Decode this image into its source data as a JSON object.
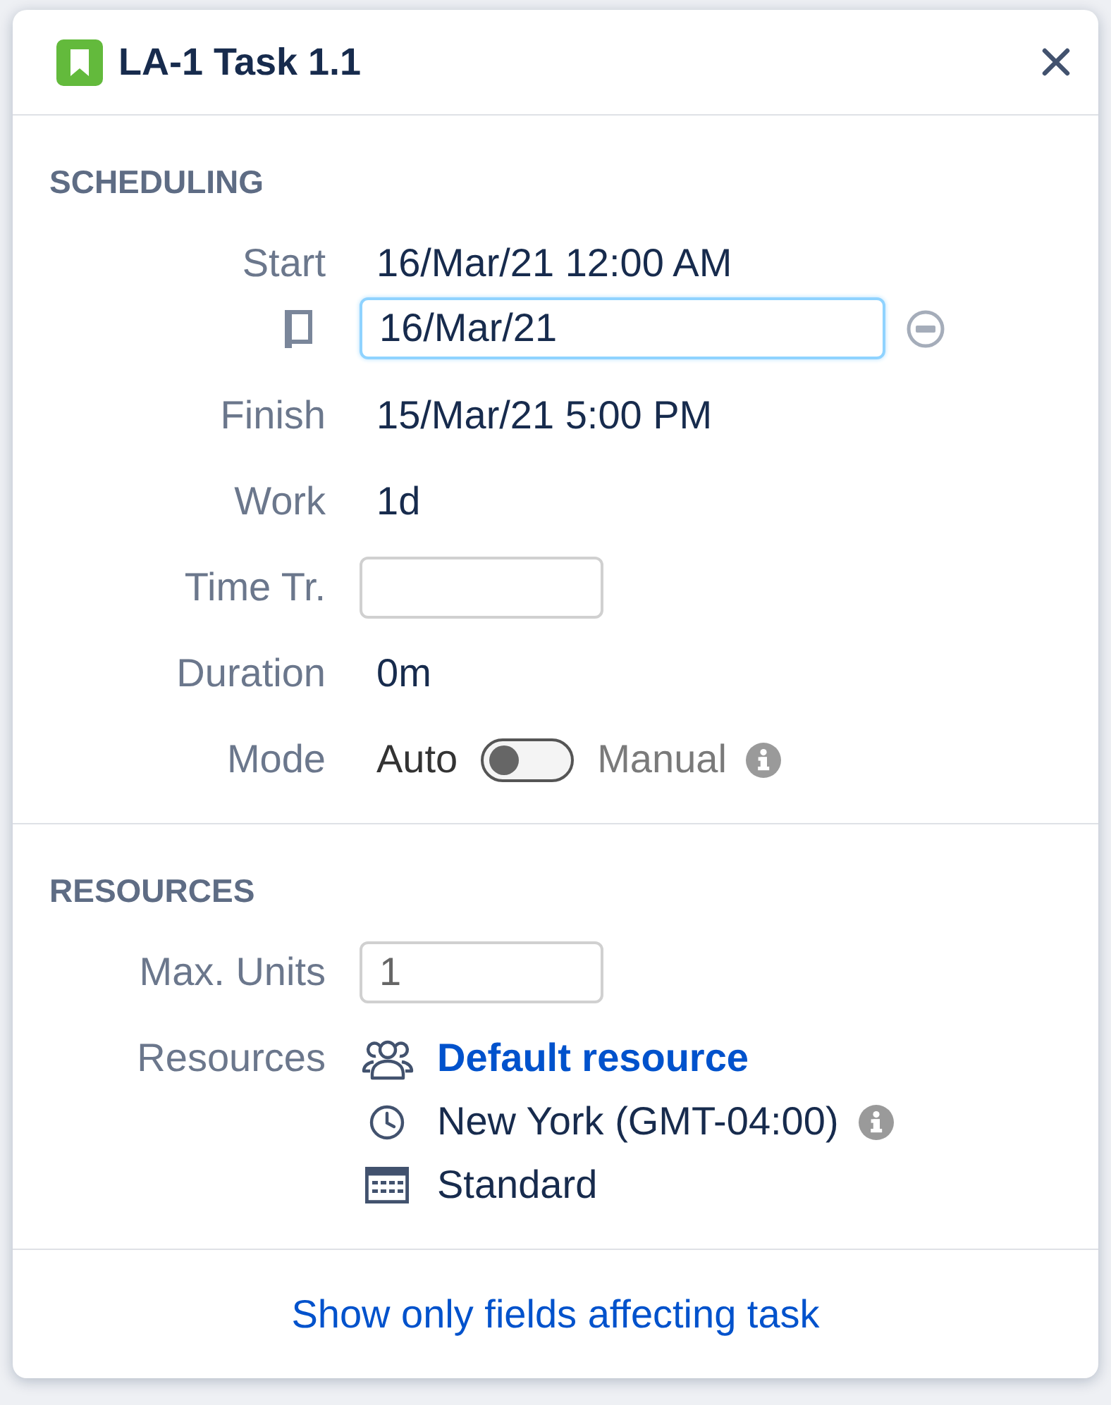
{
  "dialog": {
    "title": "LA-1 Task 1.1"
  },
  "sections": [
    {
      "heading": "SCHEDULING",
      "fields": [
        {
          "kind": "date",
          "label": "Start",
          "value": "16/Mar/21 12:00 AM",
          "input": {
            "value": "16/Mar/21",
            "focused": true
          }
        },
        {
          "kind": "text",
          "label": "Finish",
          "value": "15/Mar/21 5:00 PM"
        },
        {
          "kind": "text",
          "label": "Work",
          "value": "1d"
        },
        {
          "kind": "input",
          "label": "Time Tr."
        },
        {
          "kind": "text",
          "label": "Duration",
          "value": "0m"
        },
        {
          "kind": "toggle",
          "label": "Mode",
          "off_label": "Auto",
          "on_label": "Manual",
          "on": false
        }
      ]
    },
    {
      "heading": "RESOURCES",
      "fields": [
        {
          "kind": "input",
          "label": "Max. Units",
          "value": "1"
        },
        {
          "kind": "resource",
          "label": "Resources",
          "name": "Default resource",
          "timezone": "New York (GMT-04:00)",
          "calendar": "Standard"
        }
      ]
    }
  ],
  "footer_link": "Show only fields affecting task"
}
